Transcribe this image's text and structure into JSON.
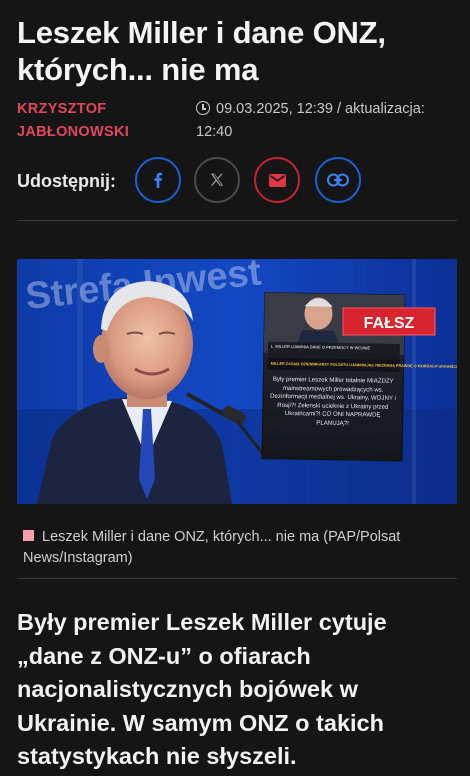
{
  "article": {
    "title": "Leszek Miller i dane ONZ, których... nie ma",
    "author": "KRZYSZTOF JABŁONOWSKI",
    "date": "09.03.2025, 12:39",
    "update_label": " / aktualizacja:",
    "update_time": "12:40",
    "share_label": "Udostępnij:",
    "image": {
      "stamp": "FAŁSZ",
      "backdrop_text": "Strefa Inwest",
      "post_headline_1": "L. MILLER UJAWNIA DANE O PRZEMOCY W WOJNIE",
      "post_headline_2": "MILLER ZAGIĄŁ DZIENNIKARZY POLSATU UJAWNIAJĄC NIEZNANĄ PRAWDĘ O MORDACH UKRAIŃCÓW",
      "post_text": "Były premier Leszek Miller totalnie MIAŻDŻY mainstreamowych prowadzących ws. Dezinformacji medialnej ws. Ukrainy, WOJNY i Rosji?! Zełenski ucieknie z Ukrainy przed Ukraińcami?! CO ONI NAPRAWDĘ PLANUJĄ?!"
    },
    "caption": "Leszek Miller i dane ONZ, których... nie ma (PAP/Polsat News/Instagram)",
    "lead": "Były premier Leszek Miller cytuje „dane z ONZ-u” o ofiarach nacjonalistycznych bojówek w Ukrainie. W samym ONZ o takich statystykach nie słyszeli."
  },
  "share_buttons": [
    {
      "name": "facebook",
      "icon": "facebook-icon",
      "color": "#1877f2"
    },
    {
      "name": "x",
      "icon": "x-icon",
      "color": "#555555"
    },
    {
      "name": "email",
      "icon": "mail-icon",
      "color": "#d92b3a"
    },
    {
      "name": "link",
      "icon": "link-icon",
      "color": "#1877f2"
    }
  ]
}
